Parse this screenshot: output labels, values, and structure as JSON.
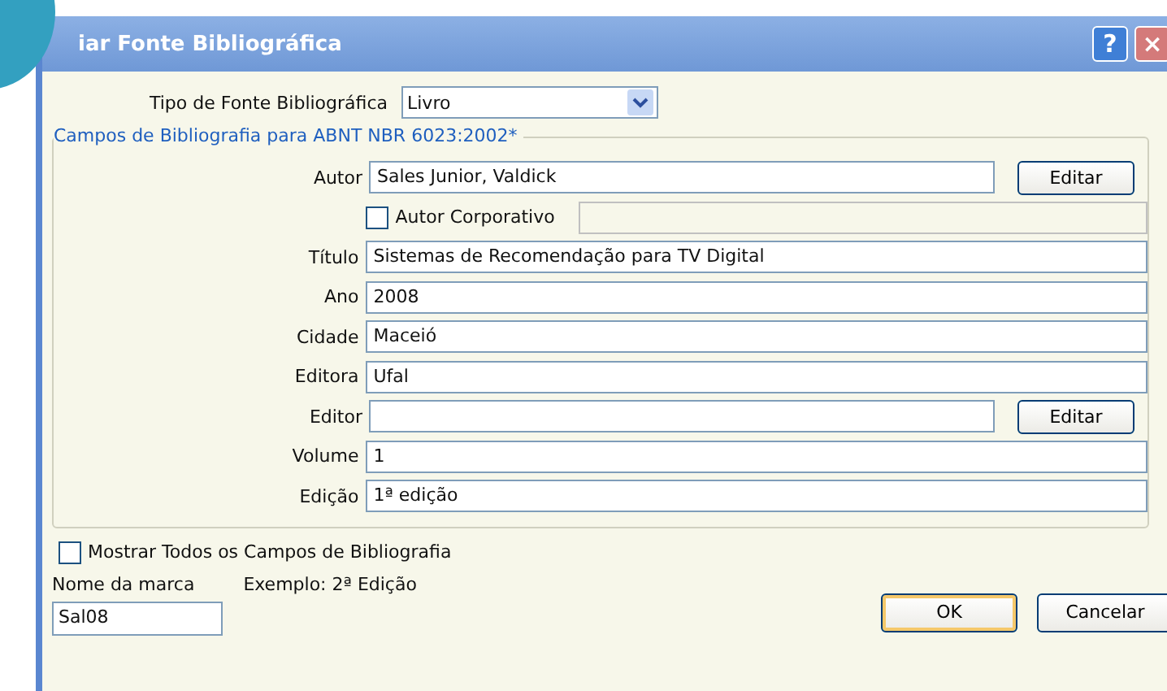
{
  "window": {
    "title": "iar Fonte Bibliográfica",
    "help": "?",
    "close": "×"
  },
  "source_type": {
    "label": "Tipo de Fonte Bibliográfica",
    "value": "Livro"
  },
  "group_title": "Campos de Bibliografia para ABNT NBR 6023:2002*",
  "fields": [
    {
      "kind": "text-button",
      "label": "Autor",
      "value": "Sales Junior, Valdick",
      "button": "Editar"
    },
    {
      "kind": "checkbox",
      "label": "Autor Corporativo",
      "checked": false
    },
    {
      "kind": "text",
      "label": "Título",
      "value": "Sistemas de Recomendação para TV Digital"
    },
    {
      "kind": "text",
      "label": "Ano",
      "value": "2008"
    },
    {
      "kind": "text",
      "label": "Cidade",
      "value": "Maceió"
    },
    {
      "kind": "text",
      "label": "Editora",
      "value": "Ufal"
    },
    {
      "kind": "text-button",
      "label": "Editor",
      "button": "Editar"
    },
    {
      "kind": "text",
      "label": "Volume",
      "value": "1"
    },
    {
      "kind": "text",
      "label": "Edição",
      "value": "1ª edição"
    }
  ],
  "show_all": {
    "label": "Mostrar Todos os Campos de Bibliografia",
    "checked": false
  },
  "tag": {
    "label": "Nome da marca",
    "example": "Exemplo: 2ª Edição",
    "value": "Sal08"
  },
  "buttons": [
    {
      "label": "OK",
      "selected": true
    },
    {
      "label": "Cancelar",
      "selected": false
    }
  ]
}
